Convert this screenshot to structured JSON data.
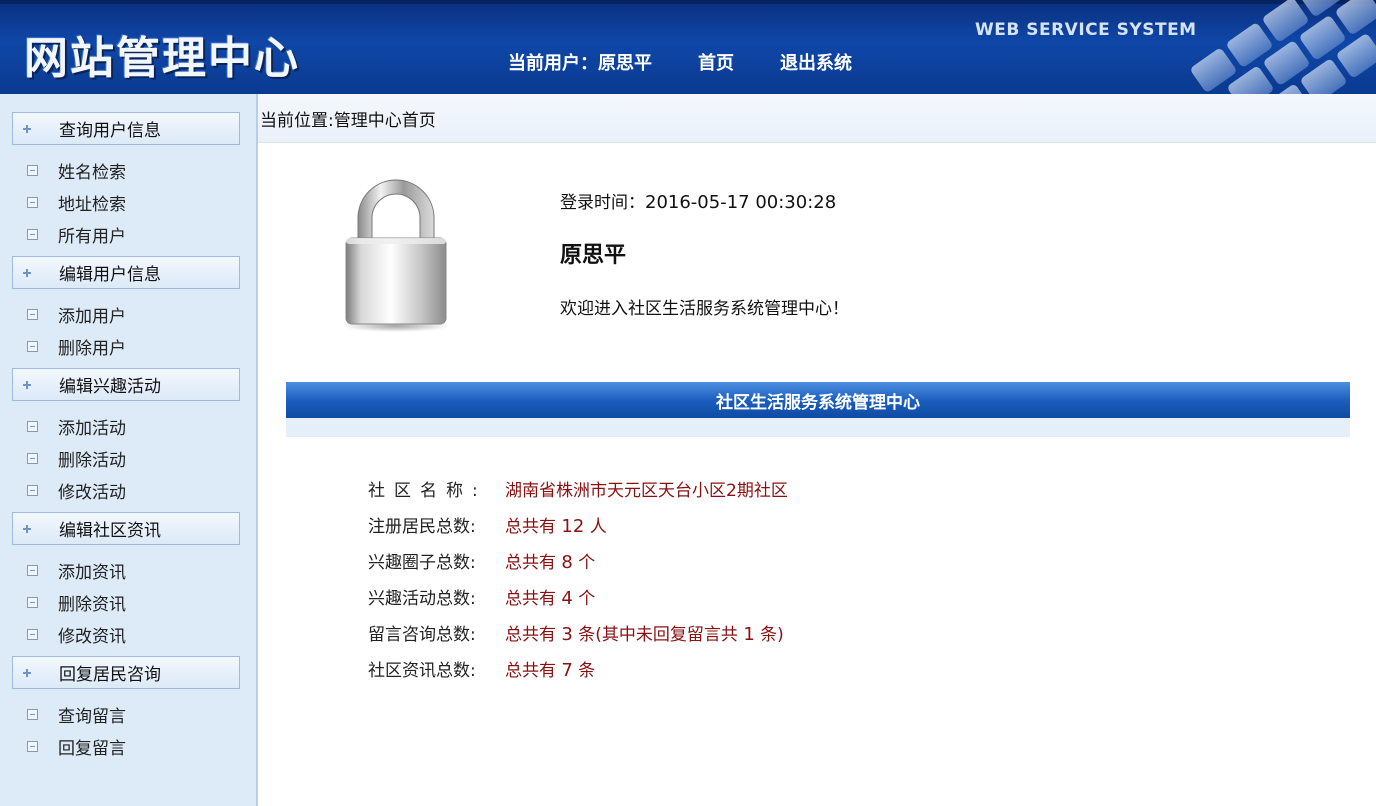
{
  "header": {
    "logo": "网站管理中心",
    "current_user_label": "当前用户：",
    "current_user_name": "原思平",
    "nav_home": "首页",
    "nav_logout": "退出系统",
    "banner_text": "WEB SERVICE SYSTEM"
  },
  "sidebar": {
    "sections": [
      {
        "label": "查询用户信息",
        "items": [
          "姓名检索",
          "地址检索",
          "所有用户"
        ]
      },
      {
        "label": "编辑用户信息",
        "items": [
          "添加用户",
          "删除用户"
        ]
      },
      {
        "label": "编辑兴趣活动",
        "items": [
          "添加活动",
          "删除活动",
          "修改活动"
        ]
      },
      {
        "label": "编辑社区资讯",
        "items": [
          "添加资讯",
          "删除资讯",
          "修改资讯"
        ]
      },
      {
        "label": "回复居民咨询",
        "items": [
          "查询留言",
          "回复留言"
        ]
      }
    ]
  },
  "breadcrumb": "当前位置:管理中心首页",
  "welcome": {
    "login_time_label": "登录时间：",
    "login_time": "2016-05-17 00:30:28",
    "user_name": "原思平",
    "message": "欢迎进入社区生活服务系统管理中心！"
  },
  "panel": {
    "title": "社区生活服务系统管理中心"
  },
  "stats": {
    "community_label": "社区名称:",
    "community_value": "湖南省株洲市天元区天台小区2期社区",
    "residents_label": "注册居民总数:",
    "residents_pre": "总共有 ",
    "residents_num": "12",
    "residents_post": " 人",
    "circles_label": "兴趣圈子总数:",
    "circles_pre": "总共有 ",
    "circles_num": "8",
    "circles_post": " 个",
    "activities_label": "兴趣活动总数:",
    "activities_pre": "总共有 ",
    "activities_num": "4",
    "activities_post": " 个",
    "messages_label": "留言咨询总数:",
    "messages_pre": "总共有 ",
    "messages_num": "3",
    "messages_mid": " 条(其中未回复留言共 ",
    "messages_unreplied": "1",
    "messages_post": " 条)",
    "news_label": "社区资讯总数:",
    "news_pre": "总共有 ",
    "news_num": "7",
    "news_post": " 条"
  }
}
